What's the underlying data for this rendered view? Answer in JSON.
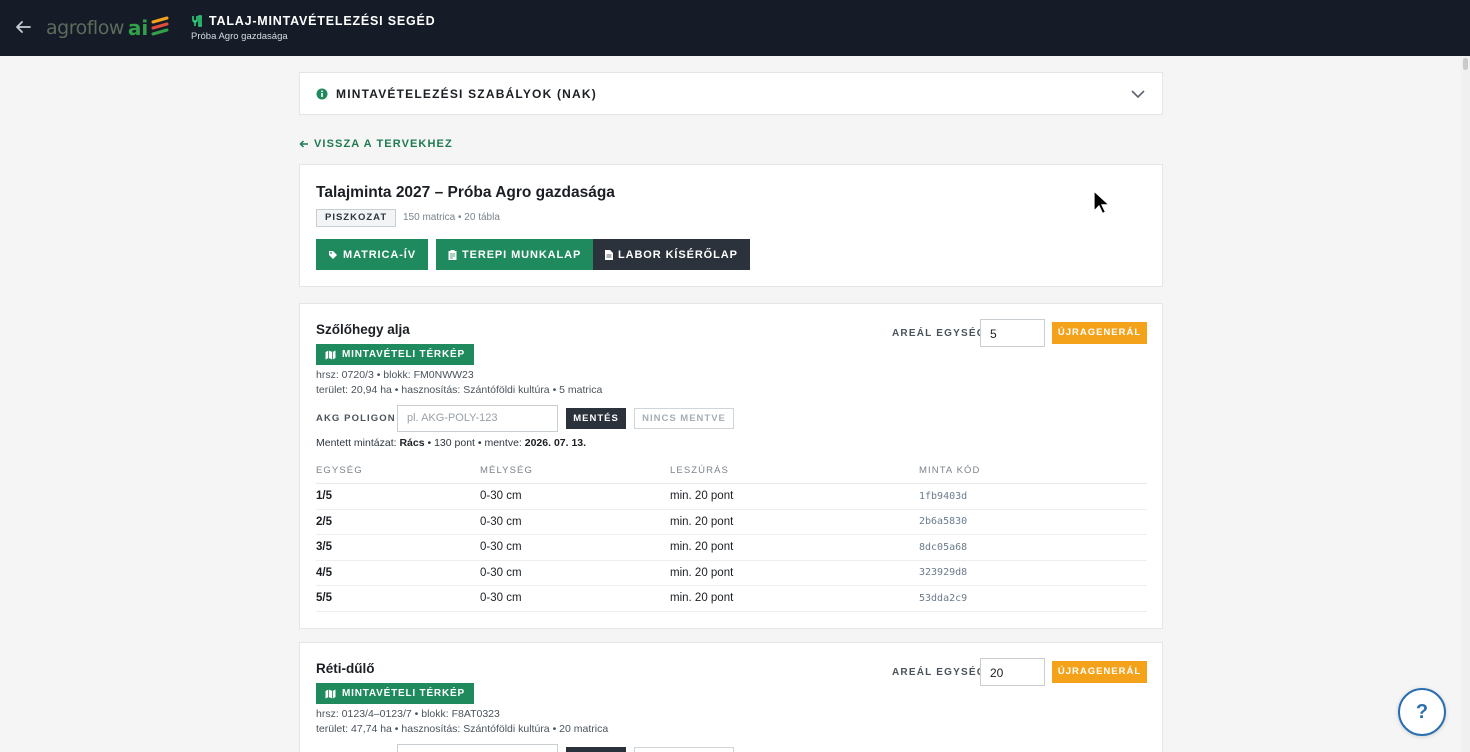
{
  "header": {
    "logo_text": "agroflow",
    "logo_ai": "ai",
    "title": "TALAJ-MINTAVÉTELEZÉSI SEGÉD",
    "subtitle": "Próba Agro gazdasága"
  },
  "rules": {
    "title": "MINTAVÉTELEZÉSI SZABÁLYOK (NAK)"
  },
  "back_link": "VISSZA A TERVEKHEZ",
  "plan": {
    "title": "Talajminta 2027 – Próba Agro gazdasága",
    "status": "PISZKOZAT",
    "meta": "150 matrica • 20 tábla",
    "buttons": {
      "matrica": "MATRICA-ÍV",
      "terepi": "TEREPI MUNKALAP",
      "labor": "LABOR KÍSÉRŐLAP"
    }
  },
  "fields": [
    {
      "name": "Szőlőhegy alja",
      "map_button": "MINTAVÉTELI TÉRKÉP",
      "line1": "hrsz: 0720/3 • blokk: FM0NWW23",
      "line2": "terület: 20,94 ha • hasznosítás: Szántóföldi kultúra • 5 matrica",
      "areal_label": "AREÁL EGYSÉG",
      "areal_value": "5",
      "regen": "ÚJRAGENERÁL",
      "akg_label": "AKG POLIGON",
      "akg_placeholder": "pl. AKG-POLY-123",
      "save": "MENTÉS",
      "saved_state": "NINCS MENTVE",
      "saved_prefix": "Mentett mintázat:",
      "saved_pattern": "Rács",
      "saved_points": "• 130 pont • mentve:",
      "saved_date": "2026. 07. 13.",
      "table": {
        "headers": [
          "EGYSÉG",
          "MÉLYSÉG",
          "LESZÚRÁS",
          "MINTA KÓD"
        ],
        "rows": [
          {
            "unit": "1/5",
            "depth": "0-30 cm",
            "stab": "min. 20 pont",
            "code": "1fb9403d"
          },
          {
            "unit": "2/5",
            "depth": "0-30 cm",
            "stab": "min. 20 pont",
            "code": "2b6a5830"
          },
          {
            "unit": "3/5",
            "depth": "0-30 cm",
            "stab": "min. 20 pont",
            "code": "8dc05a68"
          },
          {
            "unit": "4/5",
            "depth": "0-30 cm",
            "stab": "min. 20 pont",
            "code": "323929d8"
          },
          {
            "unit": "5/5",
            "depth": "0-30 cm",
            "stab": "min. 20 pont",
            "code": "53dda2c9"
          }
        ]
      }
    },
    {
      "name": "Réti-dűlő",
      "map_button": "MINTAVÉTELI TÉRKÉP",
      "line1": "hrsz: 0123/4–0123/7 • blokk: F8AT0323",
      "line2": "terület: 47,74 ha • hasznosítás: Szántóföldi kultúra • 20 matrica",
      "areal_label": "AREÁL EGYSÉG",
      "areal_value": "20",
      "regen": "ÚJRAGENERÁL"
    }
  ],
  "help": "?",
  "colors": {
    "header_bg": "#151c28",
    "accent_green": "#1e8a5e",
    "accent_orange": "#f5a21b",
    "dark_btn": "#2b323b"
  }
}
